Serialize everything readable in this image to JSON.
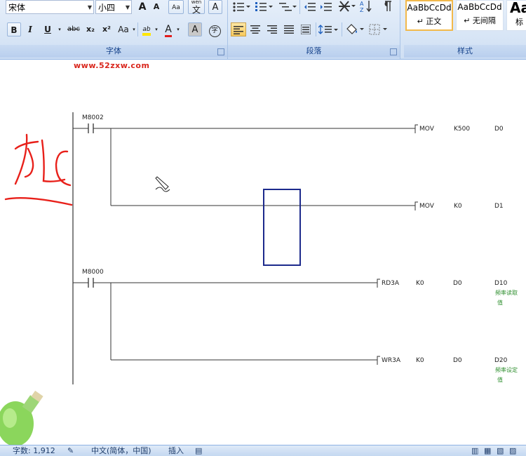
{
  "ribbon": {
    "font_group": {
      "label": "字体",
      "font_name": "宋体",
      "font_size": "小四",
      "grow_font": "A",
      "shrink_font": "A",
      "clear_format": "Aa",
      "phonetic": "wén",
      "phonetic_char": "文",
      "char_border": "A",
      "bold": "B",
      "italic": "I",
      "underline": "U",
      "strikethrough": "abc",
      "subscript": "x₂",
      "superscript": "x²",
      "change_case": "Aa",
      "highlight": "ab",
      "font_color": "A",
      "char_shading": "A",
      "enclose": "字"
    },
    "paragraph_group": {
      "label": "段落"
    },
    "styles_group": {
      "label": "样式",
      "styles": [
        {
          "sample": "AaBbCcDd",
          "name": "↵ 正文"
        },
        {
          "sample": "AaBbCcDd",
          "name": "↵ 无间隔"
        },
        {
          "sample": "Aa",
          "name": "标"
        }
      ]
    }
  },
  "document": {
    "watermark": "www.52zxw.com",
    "ladder": {
      "rung1": {
        "contact": "M8002",
        "instr1": [
          "MOV",
          "K500",
          "D0"
        ],
        "instr2": [
          "MOV",
          "K0",
          "D1"
        ]
      },
      "rung2": {
        "contact": "M8000",
        "instr1": [
          "RD3A",
          "K0",
          "D0",
          "D10"
        ],
        "instr2": [
          "WR3A",
          "K0",
          "D0",
          "D20"
        ],
        "comment1": [
          "频率读取",
          "值"
        ],
        "comment2": [
          "频率设定",
          "值"
        ]
      }
    },
    "colors": {
      "selection_box": "#1c2a8c",
      "annotation": "#e8201a",
      "comment": "#2f8f2f"
    }
  },
  "status": {
    "word_count": "字数: 1,912",
    "language": "中文(简体，中国)",
    "insert_mode": "插入"
  }
}
